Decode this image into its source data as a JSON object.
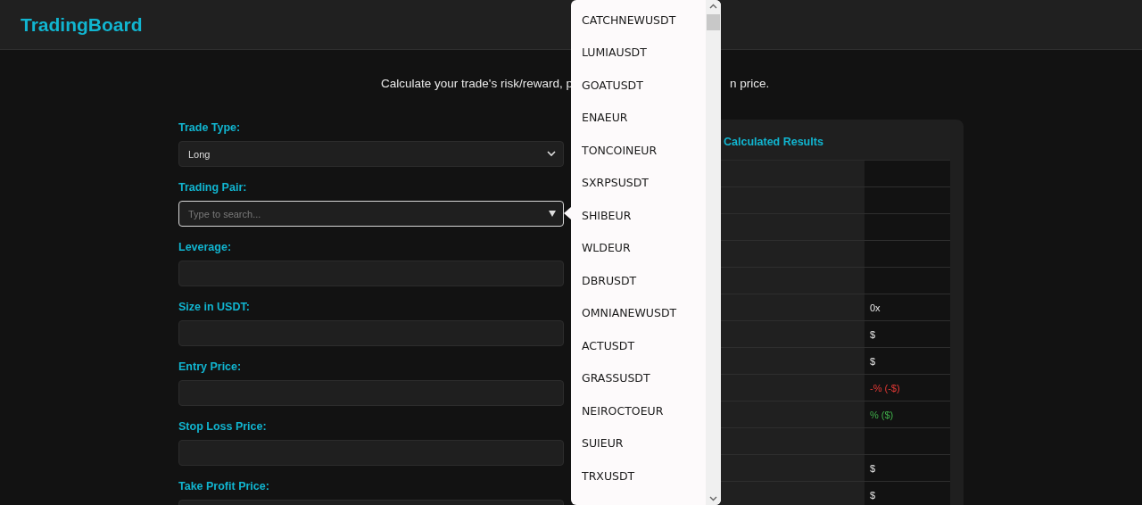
{
  "header": {
    "logo": "TradingBoard"
  },
  "subtitle": {
    "before_dropdown": "Calculate your trade's risk/reward, p",
    "after_dropdown": "n price."
  },
  "form": {
    "fields": [
      {
        "label": "Trade Type:",
        "kind": "select",
        "value": "Long",
        "focused": false
      },
      {
        "label": "Trading Pair:",
        "kind": "search",
        "placeholder": "Type to search...",
        "focused": true
      },
      {
        "label": "Leverage:",
        "kind": "input",
        "focused": false
      },
      {
        "label": "Size in USDT:",
        "kind": "input",
        "focused": false
      },
      {
        "label": "Entry Price:",
        "kind": "input",
        "focused": false
      },
      {
        "label": "Stop Loss Price:",
        "kind": "input",
        "focused": false
      },
      {
        "label": "Take Profit Price:",
        "kind": "input",
        "focused": false
      }
    ]
  },
  "dropdown": {
    "items": [
      "CATCHNEWUSDT",
      "LUMIAUSDT",
      "GOATUSDT",
      "ENAEUR",
      "TONCOINEUR",
      "SXRPSUSDT",
      "SHIBEUR",
      "WLDEUR",
      "DBRUSDT",
      "OMNIANEWUSDT",
      "ACTUSDT",
      "GRASSUSDT",
      "NEIROCTOEUR",
      "SUIEUR",
      "TRXUSDT"
    ]
  },
  "results": {
    "title": "Calculated Results",
    "rows": [
      {
        "kind": "empty"
      },
      {
        "kind": "empty"
      },
      {
        "kind": "empty"
      },
      {
        "kind": "empty"
      },
      {
        "kind": "empty"
      },
      {
        "kind": "plain",
        "value": "0x"
      },
      {
        "kind": "plain",
        "value": "$"
      },
      {
        "kind": "plain",
        "value": "$"
      },
      {
        "kind": "loss",
        "value": "-% (-$)"
      },
      {
        "kind": "profit",
        "value": "% ($)"
      },
      {
        "kind": "empty"
      },
      {
        "kind": "plain",
        "value": "$"
      },
      {
        "kind": "plain",
        "value": "$"
      }
    ]
  }
}
